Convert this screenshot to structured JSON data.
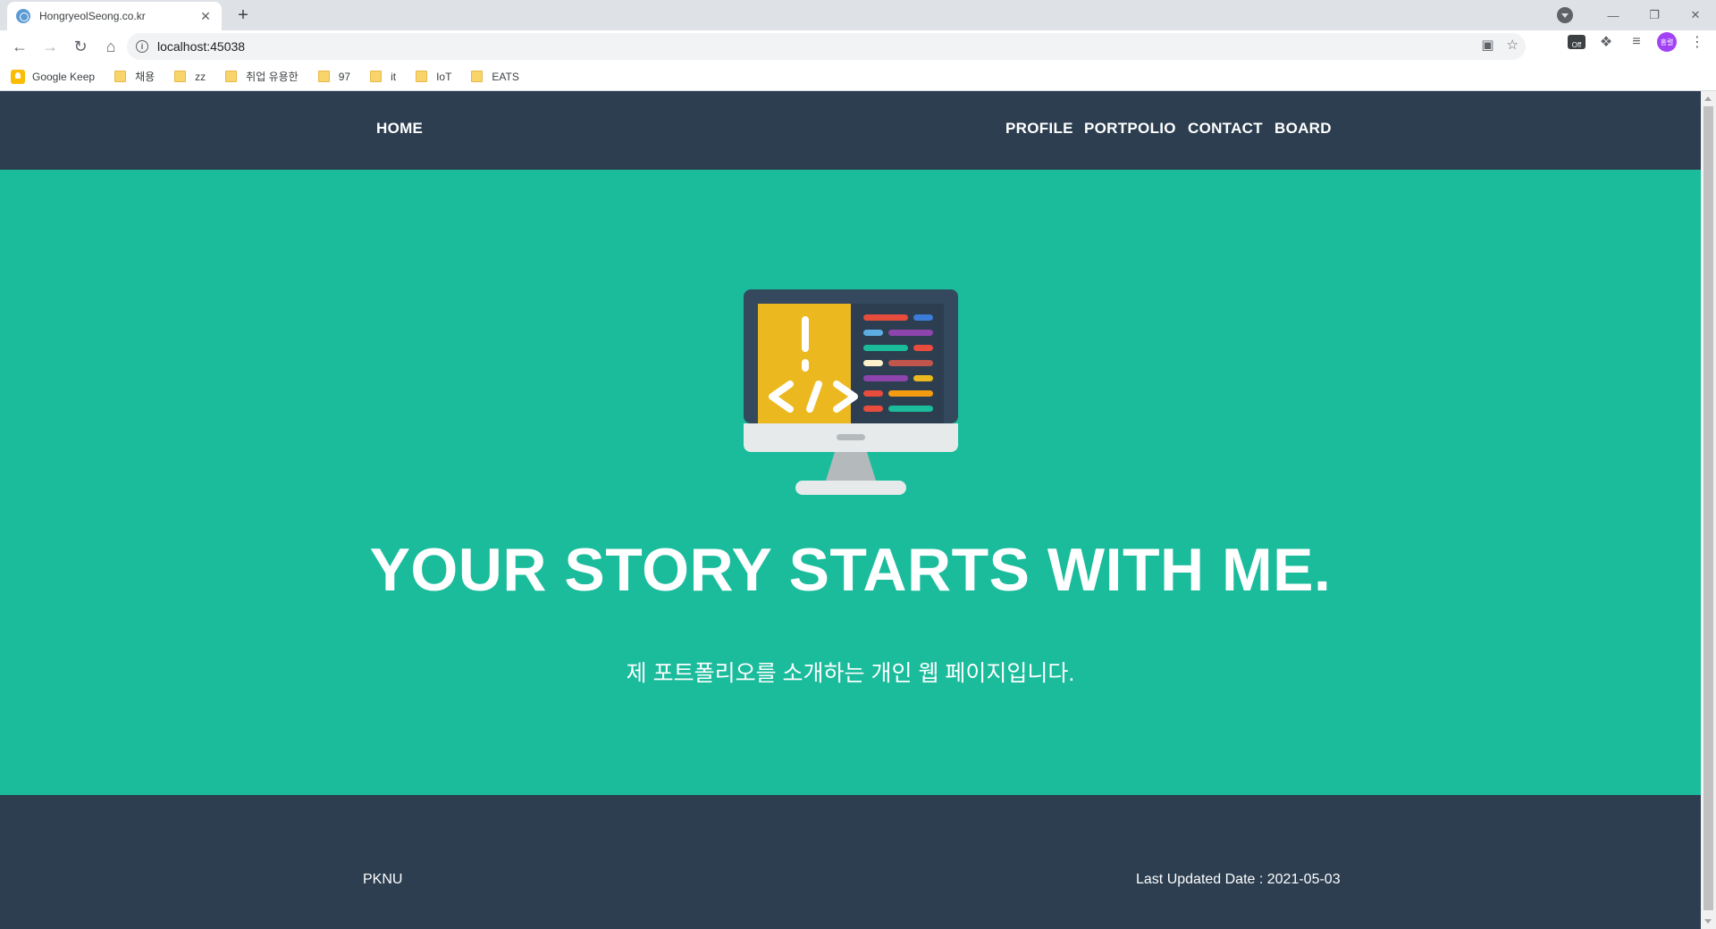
{
  "browser": {
    "tab_title": "HongryeolSeong.co.kr",
    "tab_close": "✕",
    "new_tab": "+",
    "url": "localhost:45038",
    "profile_initials": "홍렬",
    "ext_off_label": "Off",
    "win_minimize": "—",
    "win_restore": "❐",
    "win_close": "✕"
  },
  "bookmarks": [
    {
      "label": "Google Keep",
      "icon": "keep-icon"
    },
    {
      "label": "채용",
      "icon": "folder-icon"
    },
    {
      "label": "zz",
      "icon": "folder-icon"
    },
    {
      "label": "취업 유용한",
      "icon": "folder-icon"
    },
    {
      "label": "97",
      "icon": "folder-icon"
    },
    {
      "label": "it",
      "icon": "folder-icon"
    },
    {
      "label": "IoT",
      "icon": "folder-icon"
    },
    {
      "label": "EATS",
      "icon": "folder-icon"
    }
  ],
  "nav": {
    "home": "HOME",
    "profile": "PROFILE",
    "portfolio": "PORTPOLIO",
    "contact": "CONTACT",
    "board": "BOARD"
  },
  "hero": {
    "image": "monitor-code-icon",
    "title": "YOUR STORY STARTS WITH ME.",
    "subtitle": "제 포트폴리오를 소개하는 개인 웹 페이지입니다."
  },
  "footer": {
    "left": "PKNU",
    "right": "Last Updated Date : 2021-05-03"
  },
  "colors": {
    "nav_bg": "#2c3e50",
    "hero_bg": "#1abc9c",
    "footer_bg": "#2c3e50",
    "text": "#ffffff"
  }
}
